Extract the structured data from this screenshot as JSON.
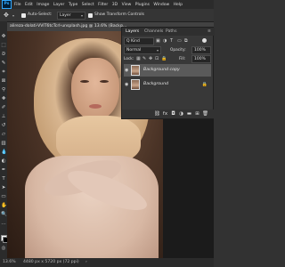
{
  "app": {
    "logo": "Ps"
  },
  "menu": [
    "File",
    "Edit",
    "Image",
    "Layer",
    "Type",
    "Select",
    "Filter",
    "3D",
    "View",
    "Plugins",
    "Window",
    "Help"
  ],
  "options": {
    "tool_icon": "move-tool-icon",
    "auto_select_label": "Auto-Select:",
    "auto_select_value": "Layer",
    "show_transform_label": "Show Transform Controls"
  },
  "document": {
    "tab_title": "alireza-dolati-VVlT6tcTcrI-unsplash.jpg @ 13.6% (Backg…",
    "close": "×"
  },
  "layers_panel": {
    "tabs": [
      "Layers",
      "Channels",
      "Paths"
    ],
    "kind_label": "Q Kind",
    "blend_mode": "Normal",
    "opacity_label": "Opacity:",
    "opacity_value": "100%",
    "lock_label": "Lock:",
    "fill_label": "Fill:",
    "fill_value": "100%",
    "layers": [
      {
        "name": "Background copy",
        "visible": true,
        "selected": true
      },
      {
        "name": "Background",
        "visible": true,
        "selected": false,
        "locked": true
      }
    ]
  },
  "status": {
    "zoom": "13.6%",
    "doc_size": "4480 px x 5720 px (72 ppi)"
  },
  "colors": {
    "foreground": "#ffffff",
    "background": "#000000",
    "accent": "#31a8ff"
  }
}
